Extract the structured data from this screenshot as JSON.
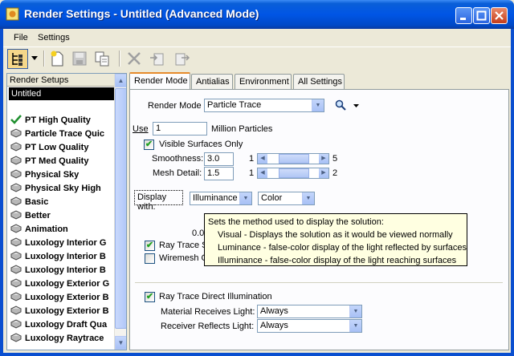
{
  "window": {
    "title": "Render Settings - Untitled (Advanced Mode)",
    "controls": [
      "minimize",
      "maximize",
      "close"
    ]
  },
  "menu": [
    "File",
    "Settings"
  ],
  "toolbar": {
    "icons": [
      "tree-view-icon",
      "dropdown-arrow-icon",
      "new-document-icon",
      "save-icon",
      "copy-icon",
      "delete-icon",
      "import-icon",
      "export-icon"
    ]
  },
  "left_panel": {
    "header": "Render Setups",
    "selected_file": "Untitled",
    "items": [
      {
        "label": "PT High Quality",
        "checked": true
      },
      {
        "label": "Particle Trace Quic",
        "checked": false
      },
      {
        "label": "PT Low Quality",
        "checked": false
      },
      {
        "label": "PT Med Quality",
        "checked": false
      },
      {
        "label": "Physical Sky",
        "checked": false
      },
      {
        "label": "Physical Sky High",
        "checked": false
      },
      {
        "label": "Basic",
        "checked": false
      },
      {
        "label": "Better",
        "checked": false
      },
      {
        "label": "Animation",
        "checked": false
      },
      {
        "label": "Luxology Interior G",
        "checked": false
      },
      {
        "label": "Luxology Interior B",
        "checked": false
      },
      {
        "label": "Luxology Interior B",
        "checked": false
      },
      {
        "label": "Luxology Exterior G",
        "checked": false
      },
      {
        "label": "Luxology Exterior B",
        "checked": false
      },
      {
        "label": "Luxology Exterior B",
        "checked": false
      },
      {
        "label": "Luxology Draft Qua",
        "checked": false
      },
      {
        "label": "Luxology Raytrace",
        "checked": false
      }
    ]
  },
  "tabs": [
    "Render Mode",
    "Antialias",
    "Environment",
    "All Settings"
  ],
  "active_tab": "Render Mode",
  "render_mode": {
    "label": "Render Mode",
    "value": "Particle Trace",
    "use_label": "Use",
    "use_value": "1",
    "use_units": "Million Particles",
    "visible_surfaces_label": "Visible Surfaces Only",
    "visible_surfaces_checked": true,
    "smoothness": {
      "label": "Smoothness:",
      "value": "3.0",
      "min": "1",
      "max": "5",
      "fraction": 0.5
    },
    "mesh_detail": {
      "label": "Mesh Detail:",
      "value": "1.5",
      "min": "1",
      "max": "2",
      "fraction": 0.5
    },
    "display_with_label": "Display with:",
    "display_with_value": "Illuminance",
    "display_color_value": "Color",
    "partial_number": "0.00",
    "ray_trace_s_label": "Ray Trace S",
    "ray_trace_s_checked": true,
    "wiremesh_label": "Wiremesh O",
    "wiremesh_checked": false,
    "tooltip": {
      "line1": "Sets the method used to display the solution:",
      "line2": "Visual - Displays the solution as it would be viewed normally",
      "line3": "Luminance - false-color display of the light reflected by surfaces",
      "line4": "Illuminance - false-color display of the light reaching surfaces"
    },
    "ray_trace_direct_label": "Ray Trace Direct Illumination",
    "ray_trace_direct_checked": true,
    "material_receives_label": "Material Receives Light:",
    "material_receives_value": "Always",
    "receiver_reflects_label": "Receiver Reflects Light:",
    "receiver_reflects_value": "Always"
  },
  "colors": {
    "titlebar": "#0055e5",
    "tab_highlight": "#e68b2c",
    "selection": "#000000",
    "tooltip_bg": "#ffffe1"
  }
}
